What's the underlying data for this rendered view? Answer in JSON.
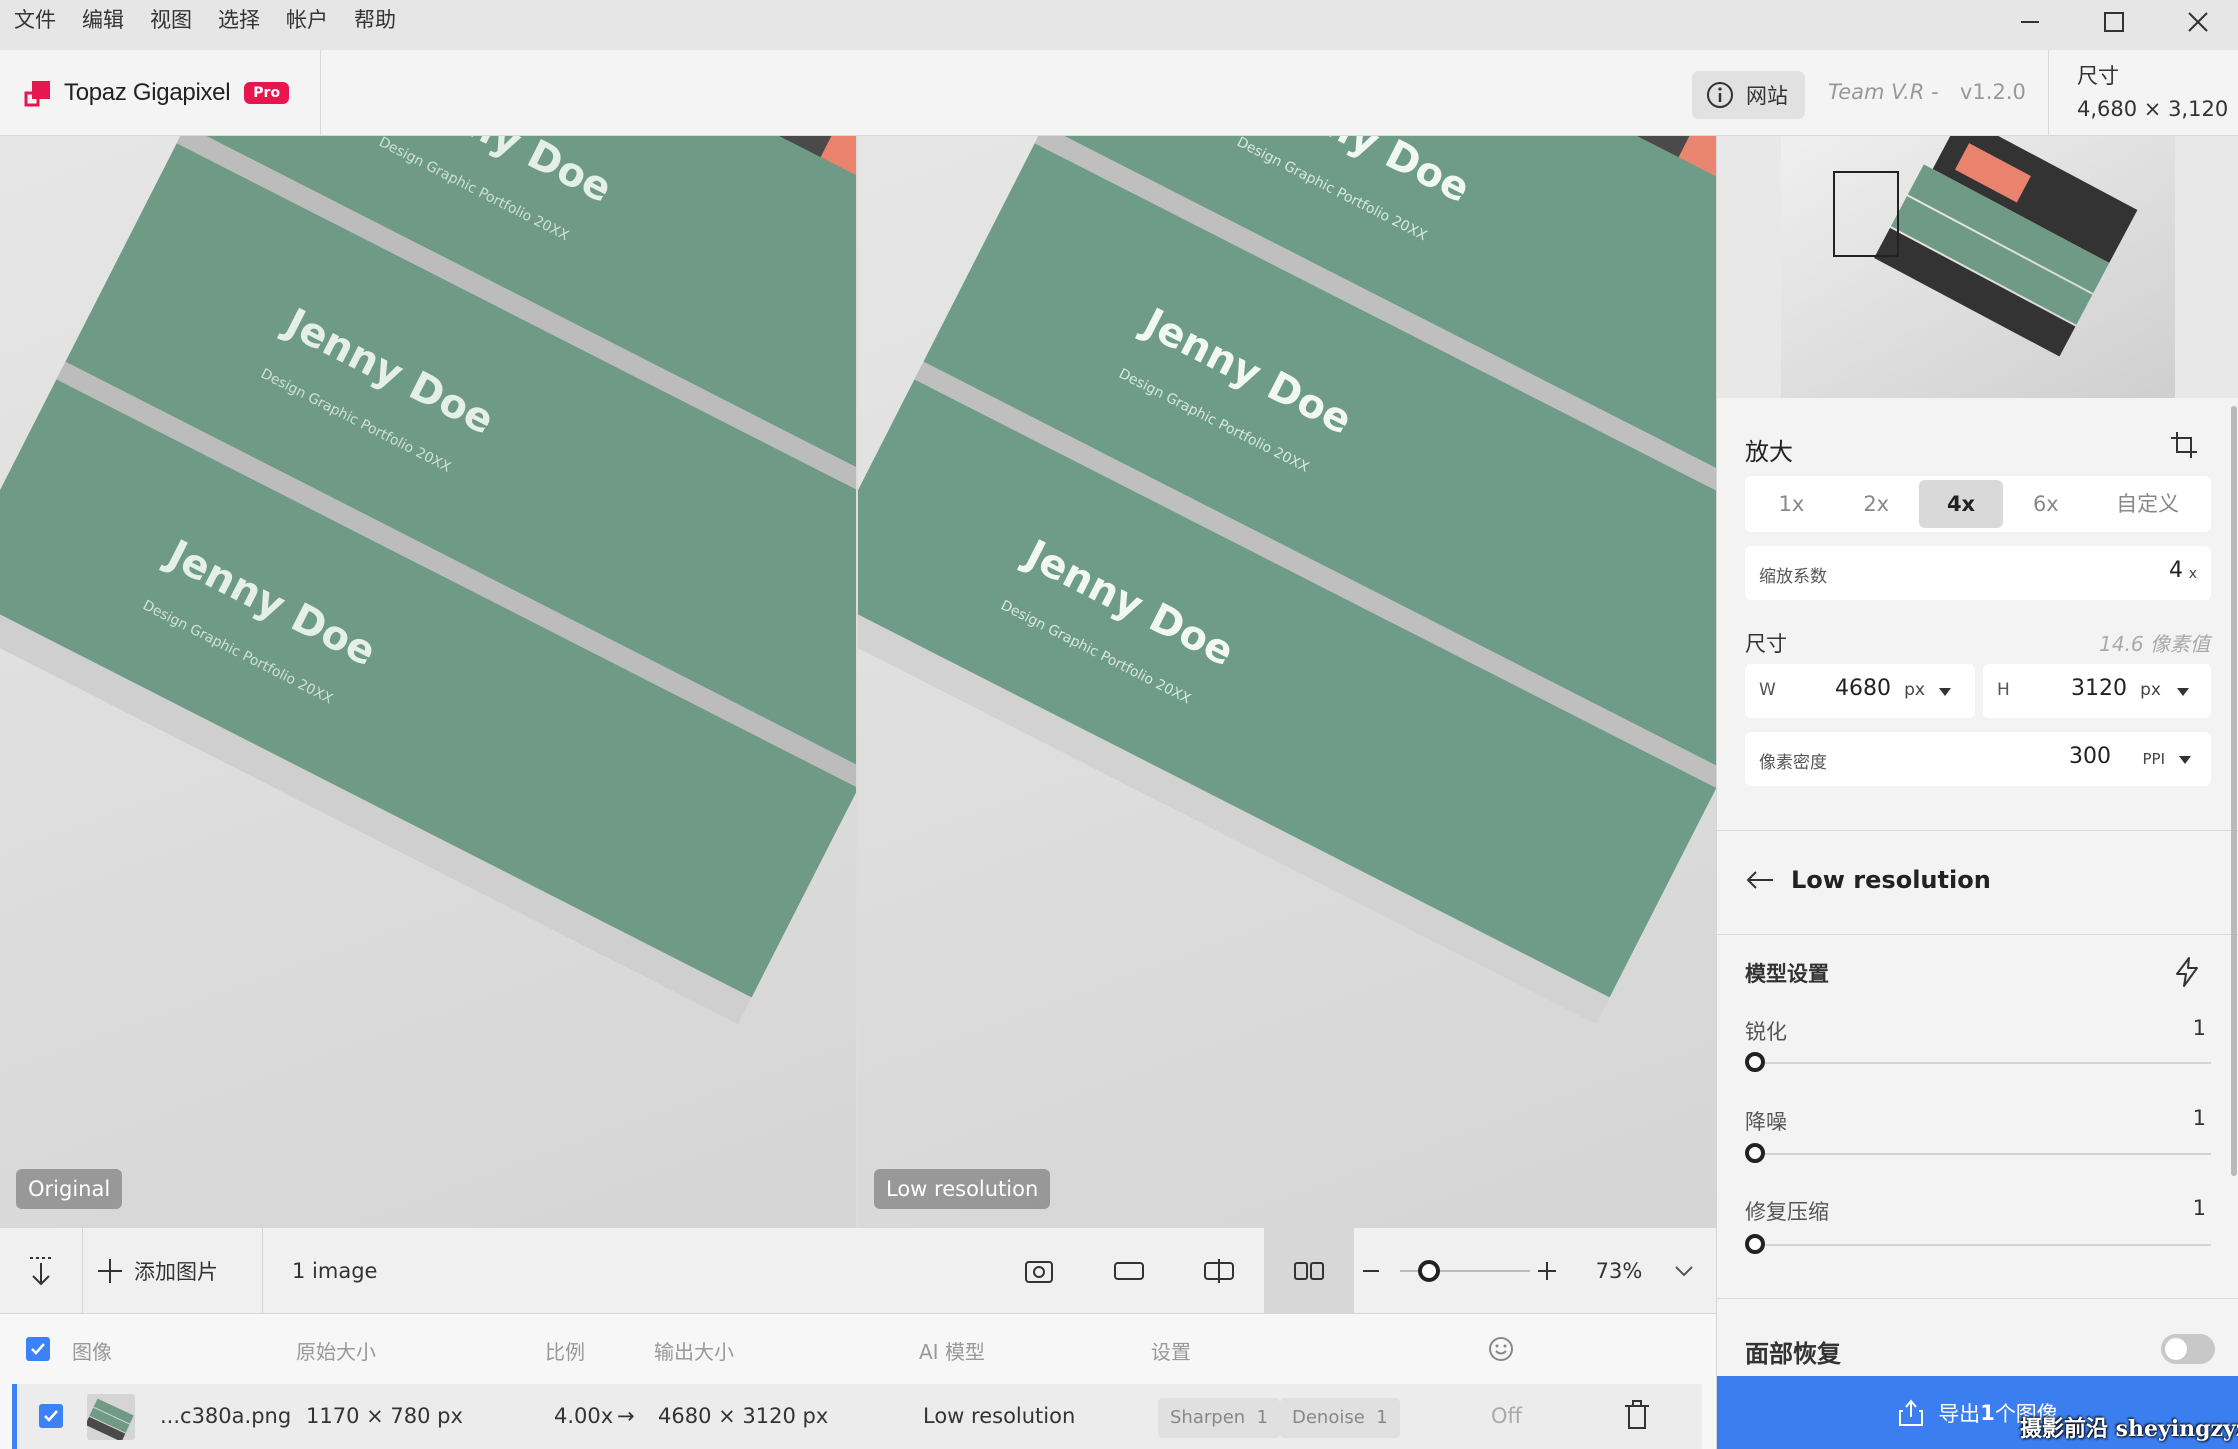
{
  "menu": [
    "文件",
    "编辑",
    "视图",
    "选择",
    "帐户",
    "帮助"
  ],
  "header": {
    "brand": "Topaz Gigapixel",
    "badge": "Pro",
    "website_label": "网站",
    "team": "Team V.R -",
    "version": "v1.2.0",
    "dimensions_title": "尺寸",
    "dimensions_value": "4,680 × 3,120"
  },
  "preview": {
    "left_label": "Original",
    "right_label": "Low resolution",
    "card_name": "Jenny Doe",
    "card_sub": "Design Graphic Portfolio 20XX"
  },
  "toolbar": {
    "add_image": "添加图片",
    "image_count": "1 image",
    "zoom": "73%",
    "zoom_fraction": 0.22
  },
  "table": {
    "headers": [
      "图像",
      "原始大小",
      "比例",
      "输出大小",
      "AI 模型",
      "设置"
    ],
    "row": {
      "filename": "...c380a.png",
      "original_size": "1170 × 780 px",
      "scale": "4.00x",
      "arrow": "→",
      "output_size": "4680 × 3120 px",
      "model": "Low resolution",
      "sharpen_label": "Sharpen",
      "sharpen_val": "1",
      "denoise_label": "Denoise",
      "denoise_val": "1",
      "face": "Off"
    }
  },
  "panel": {
    "upscale_title": "放大",
    "scale_tabs": [
      "1x",
      "2x",
      "4x",
      "6x",
      "自定义"
    ],
    "active_tab": "4x",
    "scale_factor_label": "缩放系数",
    "scale_factor_value": "4",
    "scale_factor_unit": "x",
    "size_title": "尺寸",
    "size_note": "14.6 像素值",
    "w_label": "W",
    "w_value": "4680",
    "w_unit": "px",
    "h_label": "H",
    "h_value": "3120",
    "h_unit": "px",
    "ppi_label": "像素密度",
    "ppi_value": "300",
    "ppi_unit": "PPI",
    "model_name": "Low resolution",
    "model_settings_title": "模型设置",
    "sliders": [
      {
        "label": "锐化",
        "value": "1"
      },
      {
        "label": "降噪",
        "value": "1"
      },
      {
        "label": "修复压缩",
        "value": "1"
      }
    ],
    "face_title": "面部恢复",
    "export_label_pre": "导出 ",
    "export_count": "1",
    "export_label_post": " 个图像"
  },
  "watermark": "摄影前沿 sheyingzyz.com",
  "colors": {
    "accent": "#3b7ef0",
    "brand": "#e8164f",
    "card_green": "#6f9a86",
    "card_coral": "#e9836d",
    "card_dark": "#4a4a4a"
  }
}
